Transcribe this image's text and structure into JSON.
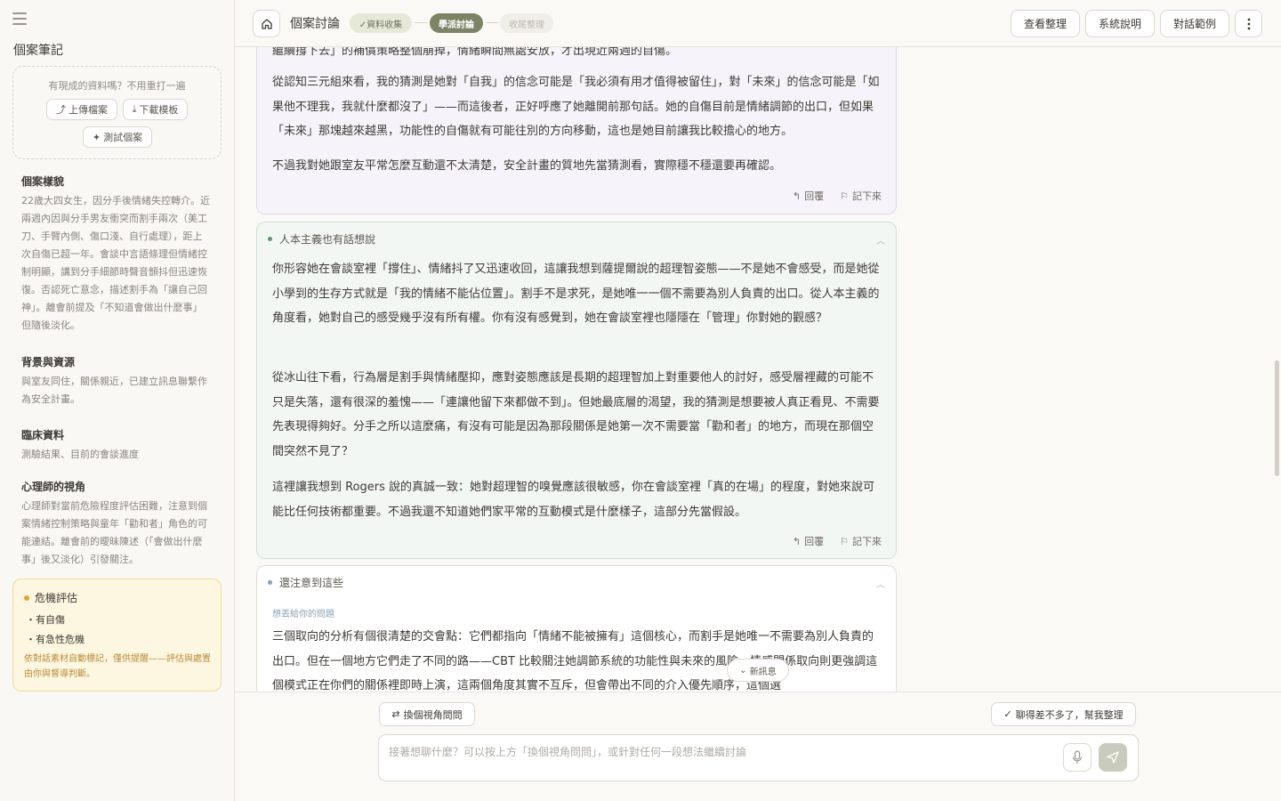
{
  "sidebar": {
    "title": "個案筆記",
    "upload_hint": "有現成的資料嗎？不用重打一遍",
    "upload_label": "上傳檔案",
    "download_label": "下載模板",
    "test_label": "測試個案",
    "sections": [
      {
        "title": "個案樣貌",
        "body": "22歲大四女生，因分手後情緒失控轉介。近兩週內因與分手男友衝突而割手兩次（美工刀、手臂內側、傷口淺、自行處理），距上次自傷已超一年。會談中言語條理但情緒控制明顯，講到分手細節時聲音顫抖但迅速恢復。否認死亡意念，描述割手為「讓自己回神」。離會前提及「不知道會做出什麼事」但隨後淡化。"
      },
      {
        "title": "背景與資源",
        "body": "與室友同住，關係親近，已建立訊息聯繫作為安全計畫。"
      },
      {
        "title": "臨床資料",
        "body": "測驗結果、目前的會談進度"
      },
      {
        "title": "心理師的視角",
        "body": "心理師對當前危險程度評估困難，注意到個案情緒控制策略與童年「勸和者」角色的可能連結。離會前的曖昧陳述（「會做出什麼事」後又淡化）引發關注。"
      }
    ],
    "crisis": {
      "title": "危機評估",
      "items": [
        "・有自傷",
        "・有急性危機"
      ],
      "note": "依對話素材自動標記，僅供提醒——評估與處置由你與督導判斷。"
    }
  },
  "topbar": {
    "title": "個案討論",
    "stages": [
      "✓資料收集",
      "學派討論",
      "收尾整理"
    ],
    "buttons": [
      "查看整理",
      "系統說明",
      "對話範例"
    ]
  },
  "chat": {
    "card1": {
      "paragraphs": [
        "繼續撐下去」的補償策略整個崩掉，情緒瞬間無處安放，才出現近兩週的自傷。",
        "從認知三元組來看，我的猜測是她對「自我」的信念可能是「我必須有用才值得被留住」，對「未來」的信念可能是「如果他不理我，我就什麼都沒了」——而這後者，正好呼應了她離開前那句話。她的自傷目前是情緒調節的出口，但如果「未來」那塊越來越黑，功能性的自傷就有可能往別的方向移動，這也是她目前讓我比較擔心的地方。",
        "不過我對她跟室友平常怎麼互動還不太清楚，安全計畫的質地先當猜測看，實際穩不穩還要再確認。"
      ]
    },
    "card2": {
      "title": "人本主義也有話想說",
      "paragraphs": [
        "你形容她在會談室裡「撐住」、情緒抖了又迅速收回，這讓我想到薩提爾說的超理智姿態——不是她不會感受，而是她從小學到的生存方式就是「我的情緒不能佔位置」。割手不是求死，是她唯一一個不需要為別人負責的出口。從人本主義的角度看，她對自己的感受幾乎沒有所有權。你有沒有感覺到，她在會談室裡也隱隱在「管理」你對她的觀感？",
        "從冰山往下看，行為層是割手與情緒壓抑，應對姿態應該是長期的超理智加上對重要他人的討好，感受層裡藏的可能不只是失落，還有很深的羞愧——「連讓他留下來都做不到」。但她最底層的渴望，我的猜測是想要被人真正看見、不需要先表現得夠好。分手之所以這麼痛，有沒有可能是因為那段關係是她第一次不需要當「勸和者」的地方，而現在那個空間突然不見了？",
        "這裡讓我想到 Rogers 說的真誠一致：她對超理智的嗅覺應該很敏感，你在會談室裡「真的在場」的程度，對她來說可能比任何技術都重要。不過我還不知道她們家平常的互動模式是什麼樣子，這部分先當假設。"
      ]
    },
    "card3": {
      "title": "還注意到這些",
      "sublabel": "想丟給你的問題",
      "paragraphs": [
        "三個取向的分析有個很清楚的交會點：它們都指向「情緒不能被擁有」這個核心，而割手是她唯一不需要為別人負責的出口。但在一個地方它們走了不同的路——CBT 比較關注她調節系統的功能性與未來的風險，情感關係取向則更強調這個模式正在你們的關係裡即時上演，這兩個角度其實不互斥，但會帶出不同的介入優先順序，這個選"
      ]
    },
    "actions": {
      "reply": "回覆",
      "save": "記下來"
    },
    "new_message": "新訊息"
  },
  "composer": {
    "switch_label": "換個視角問問",
    "summary_label": "聊得差不多了，幫我整理",
    "placeholder": "接著想聊什麼？可以按上方「換個視角問問」，或針對任何一段想法繼續討論"
  },
  "colors": {
    "accent": "#7b8565",
    "card1_bg": "#f6f4fa",
    "card2_bg": "#f3f7f4",
    "crisis_bg": "#fdf6e0",
    "dot_green": "#5a9a6e",
    "dot_blue": "#7fa0bd"
  }
}
